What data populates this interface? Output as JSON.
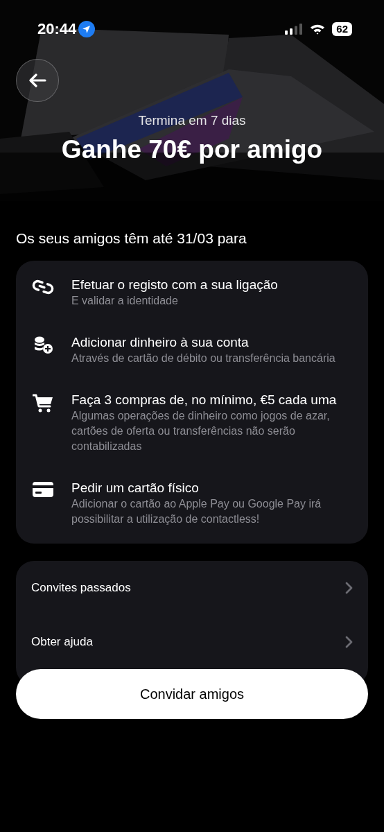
{
  "status_bar": {
    "time": "20:44",
    "battery": "62"
  },
  "header": {
    "kind": "picture",
    "subtitle": "Termina em 7 dias",
    "title": "Ganhe 70€ por amigo"
  },
  "steps_heading": "Os seus amigos têm até 31/03 para",
  "steps": [
    {
      "kind": "link",
      "title": "Efetuar o registo com a sua ligação",
      "description": "E validar a identidade"
    },
    {
      "kind": "coins",
      "title": "Adicionar dinheiro à sua conta",
      "description": "Através de cartão de débito ou transferência bancária"
    },
    {
      "kind": "cart",
      "title": "Faça 3 compras de, no mínimo, €5 cada uma",
      "description": "Algumas operações de dinheiro como jogos de azar, cartões de oferta ou transferências não serão contabilizadas"
    },
    {
      "kind": "card",
      "title": "Pedir um cartão físico",
      "description": "Adicionar o cartão ao Apple Pay ou Google Pay irá possibilitar a utilização de contactless!"
    }
  ],
  "links": [
    {
      "label": "Convites passados"
    },
    {
      "label": "Obter ajuda"
    }
  ],
  "primary_button": "Convidar amigos"
}
